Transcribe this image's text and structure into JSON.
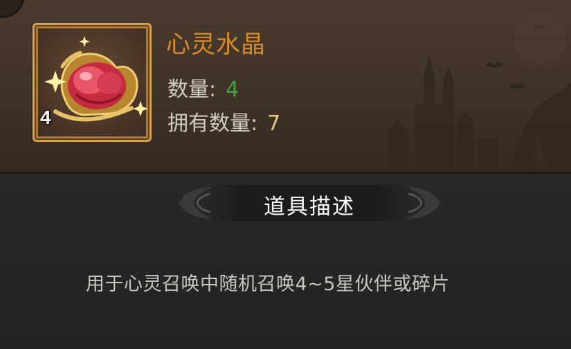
{
  "item": {
    "name": "心灵水晶",
    "stack_count": "4",
    "icon": "crystal-heart-icon",
    "quantity_label": "数量:",
    "quantity_value": "4",
    "owned_label": "拥有数量:",
    "owned_value": "7"
  },
  "description_section": {
    "title": "道具描述",
    "text": "用于心灵召唤中随机召唤4~5星伙伴或碎片"
  },
  "colors": {
    "item_name": "#d8892a",
    "quantity_value": "#3fa63a",
    "owned_value": "#e7c98c",
    "frame_border": "#d9a24f"
  }
}
